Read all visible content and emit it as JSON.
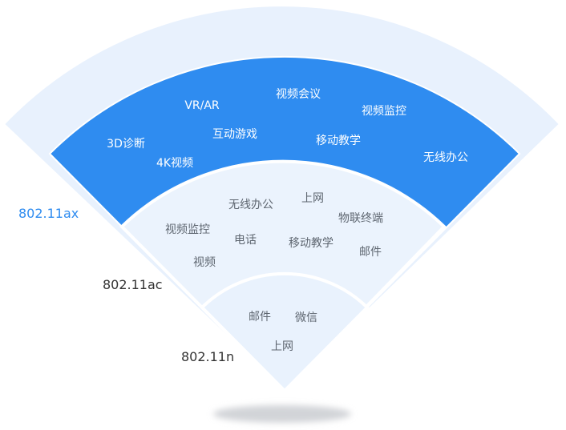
{
  "colors": {
    "outer_band": "#e8f1fd",
    "ax_band": "#2f8cf0",
    "ac_band": "#ebf3fd",
    "n_band": "#e9f2fd",
    "band_edge": "#ffffff",
    "white_text": "#ffffff",
    "grey_text": "#5e6670",
    "ax_label": "#2f8cf0",
    "std_label": "#333333",
    "shadow": "#d2d4d8"
  },
  "standards": {
    "ax": "802.11ax",
    "ac": "802.11ac",
    "n": "802.11n"
  },
  "ax_apps": [
    "VR/AR",
    "视频会议",
    "视频监控",
    "3D诊断",
    "互动游戏",
    "移动教学",
    "无线办公",
    "4K视频"
  ],
  "ac_apps": [
    "无线办公",
    "上网",
    "物联终端",
    "视频监控",
    "电话",
    "移动教学",
    "邮件",
    "视频"
  ],
  "n_apps": [
    "邮件",
    "微信",
    "上网"
  ]
}
